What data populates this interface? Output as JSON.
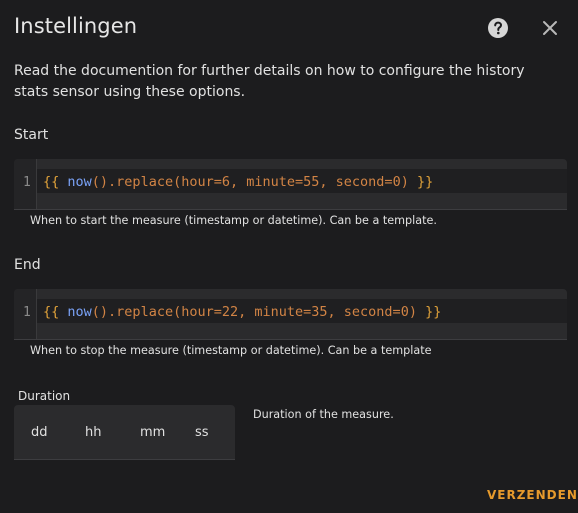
{
  "dialog": {
    "title": "Instellingen",
    "description": "Read the documention for further details on how to configure the history stats sensor using these options."
  },
  "start": {
    "label": "Start",
    "line_number": "1",
    "code": {
      "open": "{{",
      "fn": "now",
      "rest_pre": "().replace(hour=",
      "hour": "6",
      "mid1": ", minute=",
      "minute": "55",
      "mid2": ", second=",
      "second": "0",
      "end": ")",
      "close": "}}"
    },
    "helper": "When to start the measure (timestamp or datetime). Can be a template."
  },
  "end": {
    "label": "End",
    "line_number": "1",
    "code": {
      "open": "{{",
      "fn": "now",
      "rest_pre": "().replace(hour=",
      "hour": "22",
      "mid1": ", minute=",
      "minute": "35",
      "mid2": ", second=",
      "second": "0",
      "end": ")",
      "close": "}}"
    },
    "helper": "When to stop the measure (timestamp or datetime). Can be a template"
  },
  "duration": {
    "label": "Duration",
    "fields": {
      "days": "dd",
      "hours": "hh",
      "minutes": "mm",
      "seconds": "ss"
    },
    "helper": "Duration of the measure."
  },
  "actions": {
    "submit": "VERZENDEN"
  },
  "colors": {
    "accent": "#e69a2c",
    "background": "#1c1c1e",
    "code_fn": "#7aa2f7",
    "code_literal": "#d28445"
  }
}
